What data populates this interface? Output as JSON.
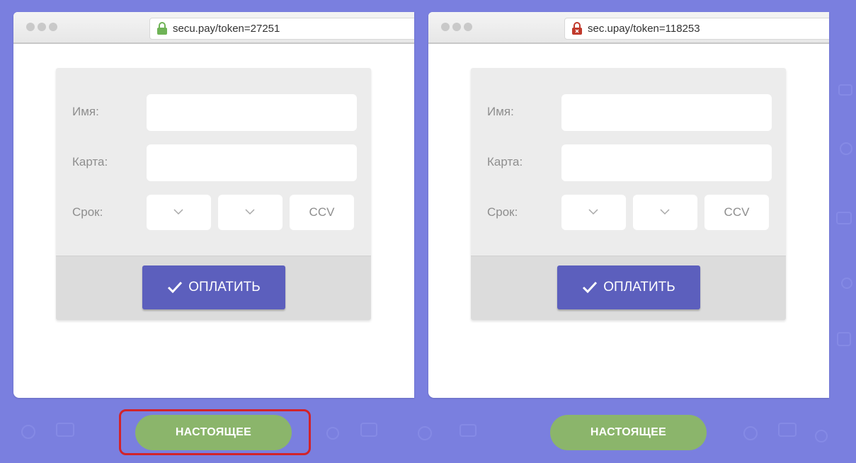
{
  "windows": [
    {
      "url": "secu.pay/token=27251",
      "lock_color": "#6fb356",
      "form": {
        "name_label": "Имя:",
        "card_label": "Карта:",
        "expiry_label": "Срок:",
        "ccv_placeholder": "CCV",
        "pay_label": "ОПЛАТИТЬ"
      },
      "verdict": "НАСТОЯЩЕЕ",
      "highlighted": true
    },
    {
      "url": "sec.upay/token=118253",
      "lock_color": "#c0392b",
      "form": {
        "name_label": "Имя:",
        "card_label": "Карта:",
        "expiry_label": "Срок:",
        "ccv_placeholder": "CCV",
        "pay_label": "ОПЛАТИТЬ"
      },
      "verdict": "НАСТОЯЩЕЕ",
      "highlighted": false
    }
  ],
  "colors": {
    "background": "#7a7fdf",
    "button": "#5c5fbd",
    "verdict": "#8bb56b",
    "highlight": "#d2232a"
  },
  "icons": [
    "lock-icon",
    "lock-broken-icon",
    "chevron-down-icon",
    "check-icon"
  ]
}
